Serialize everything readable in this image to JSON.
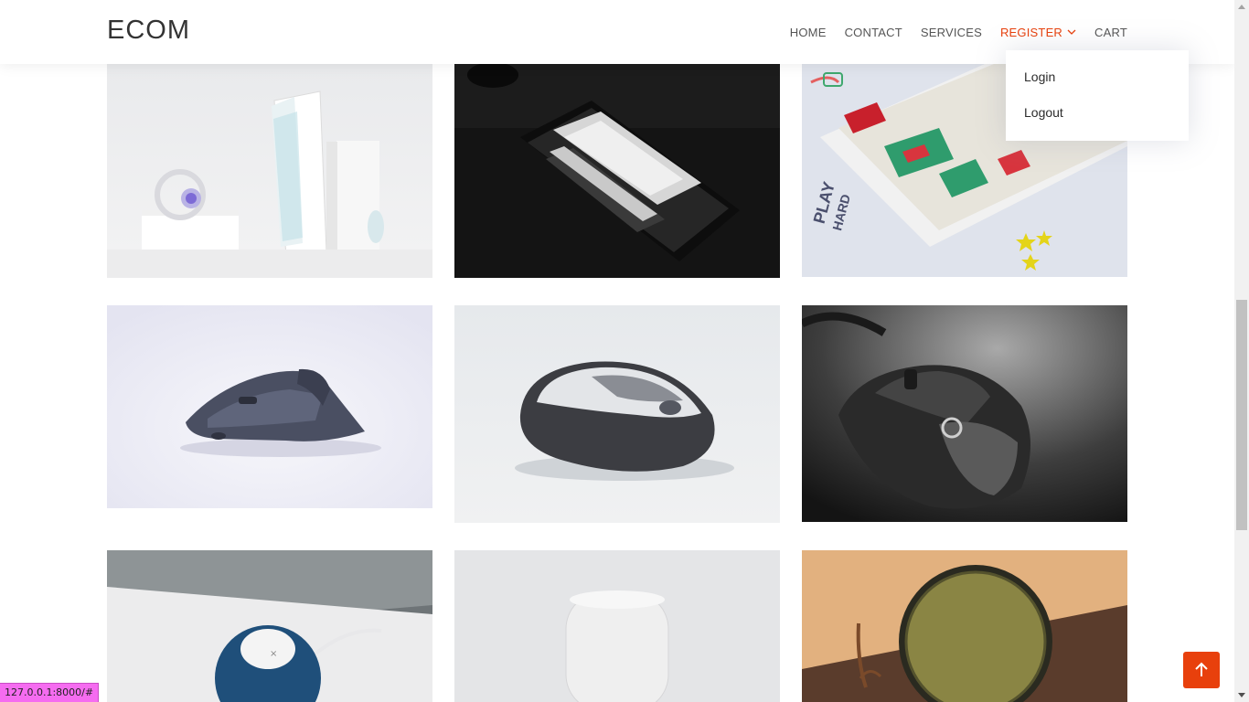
{
  "brand": "ECOM",
  "nav": {
    "items": [
      {
        "label": "HOME",
        "active": false
      },
      {
        "label": "CONTACT",
        "active": false
      },
      {
        "label": "SERVICES",
        "active": false
      },
      {
        "label": "REGISTER",
        "active": true,
        "icon": "chevron-down-icon"
      },
      {
        "label": "CART",
        "active": false
      }
    ]
  },
  "dropdown": {
    "items": [
      "Login",
      "Logout"
    ]
  },
  "gallery": {
    "items": [
      {
        "subject": "white keyboard with headphones and mouse"
      },
      {
        "subject": "black and white mechanical keyboard"
      },
      {
        "subject": "colorful keycap keyboard"
      },
      {
        "subject": "ergonomic gray mouse"
      },
      {
        "subject": "gray and silver wireless mouse"
      },
      {
        "subject": "black gaming mouse"
      },
      {
        "subject": "blue smart speaker"
      },
      {
        "subject": "white smart speaker"
      },
      {
        "subject": "olive round speaker"
      }
    ]
  },
  "back_to_top": {
    "icon": "arrow-up-icon"
  },
  "status_bar": {
    "url": "127.0.0.1:8000/#"
  },
  "colors": {
    "accent": "#e8400c",
    "text": "#555555",
    "brand_text": "#333333"
  }
}
